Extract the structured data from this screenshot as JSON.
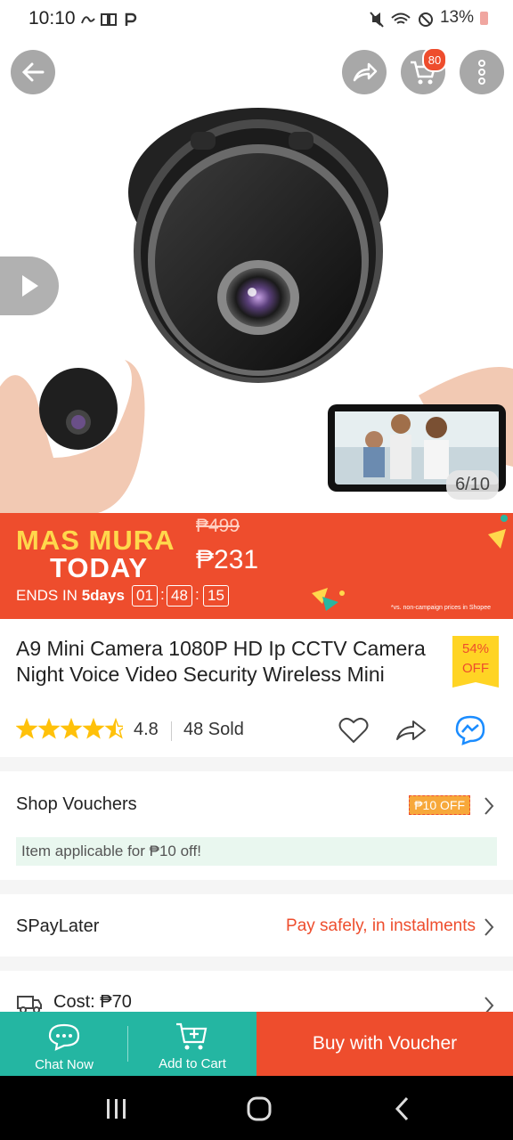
{
  "status_bar": {
    "time": "10:10",
    "battery": "13%"
  },
  "hero": {
    "image_counter": "6/10"
  },
  "header": {
    "cart_count": "80"
  },
  "flash_sale": {
    "label_line1": "MAS MURA",
    "label_line2": "TODAY",
    "original_price": "₱499",
    "sale_price": "₱231",
    "ends_prefix": "ENDS IN",
    "ends_days": "5days",
    "hours": "01",
    "minutes": "48",
    "seconds": "15",
    "fine_print": "*vs. non-campaign prices in Shopee"
  },
  "product": {
    "title": "A9 Mini Camera 1080P HD Ip CCTV Camera Night Voice Video Security Wireless Mini",
    "discount_pct": "54%",
    "discount_word": "OFF",
    "rating": "4.8",
    "stars": 4.5,
    "sold": "48 Sold"
  },
  "vouchers": {
    "label": "Shop Vouchers",
    "tag": "₱10 OFF",
    "applicable": "Item applicable for ₱10 off!"
  },
  "spaylater": {
    "label": "SPayLater",
    "text": "Pay safely, in instalments"
  },
  "shipping": {
    "cost": "Cost: ₱70"
  },
  "bottom_bar": {
    "chat": "Chat Now",
    "add_to_cart": "Add to Cart",
    "buy": "Buy with Voucher"
  },
  "colors": {
    "brand": "#ee4d2d",
    "teal": "#24b6a2",
    "yellow": "#ffd424"
  }
}
